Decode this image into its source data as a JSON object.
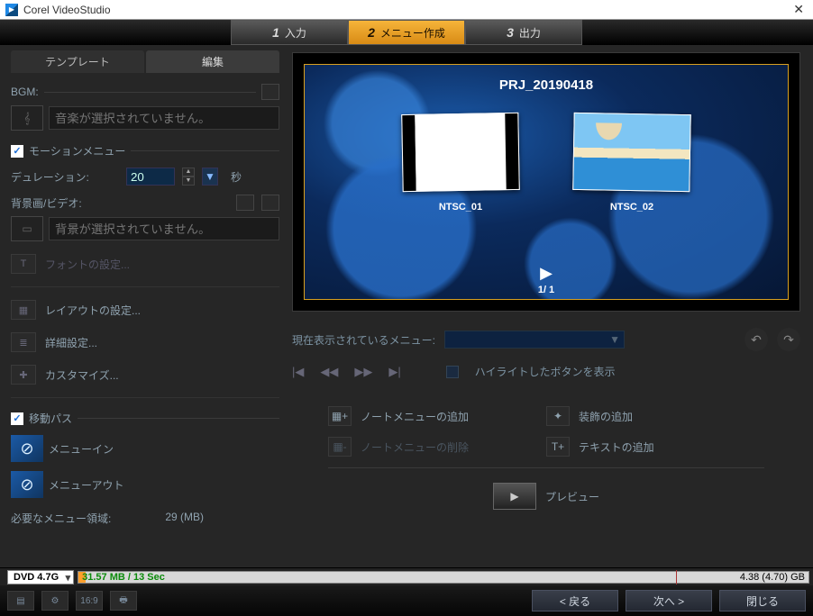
{
  "window": {
    "title": "Corel VideoStudio"
  },
  "steps": [
    {
      "num": "1",
      "label": "入力"
    },
    {
      "num": "2",
      "label": "メニュー作成"
    },
    {
      "num": "3",
      "label": "出力"
    }
  ],
  "activeStep": 1,
  "leftTabs": {
    "template": "テンプレート",
    "edit": "編集"
  },
  "bgm": {
    "label": "BGM:",
    "placeholder": "音楽が選択されていません。"
  },
  "motion": {
    "checkLabel": "モーションメニュー",
    "durationLabel": "デュレーション:",
    "durationValue": "20",
    "secLabel": "秒"
  },
  "background": {
    "label": "背景画/ビデオ:",
    "placeholder": "背景が選択されていません。"
  },
  "menuItems": {
    "font": "フォントの設定...",
    "layout": "レイアウトの設定...",
    "advanced": "詳細設定...",
    "customize": "カスタマイズ..."
  },
  "path": {
    "checkLabel": "移動パス",
    "menuIn": "メニューイン",
    "menuOut": "メニューアウト"
  },
  "required": {
    "label": "必要なメニュー領域:",
    "value": "29 (MB)"
  },
  "preview": {
    "projTitle": "PRJ_20190418",
    "thumb1": "NTSC_01",
    "thumb2": "NTSC_02",
    "page": "1/ 1"
  },
  "below": {
    "currentMenuLabel": "現在表示されているメニュー:",
    "highlightLabel": "ハイライトしたボタンを表示"
  },
  "actions": {
    "addNote": "ノートメニューの追加",
    "delNote": "ノートメニューの削除",
    "addDeco": "装飾の追加",
    "addText": "テキストの追加",
    "preview": "プレビュー"
  },
  "capacity": {
    "disc": "DVD 4.7G",
    "used": "31.57 MB / 13 Sec",
    "total": "4.38 (4.70) GB"
  },
  "bottom": {
    "aspect": "16:9",
    "back": "< 戻る",
    "next": "次へ >",
    "close": "閉じる"
  }
}
